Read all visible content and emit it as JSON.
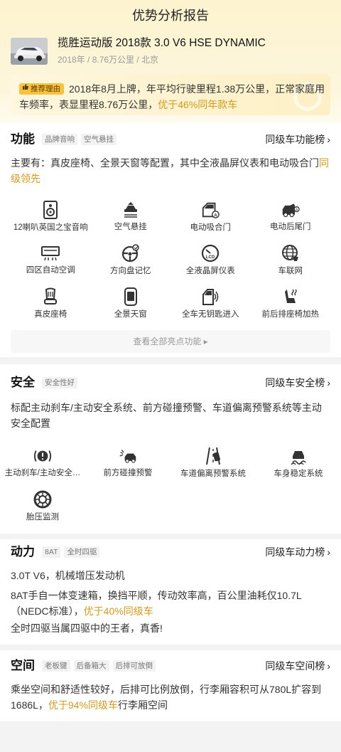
{
  "header": {
    "title": "优势分析报告"
  },
  "car": {
    "name": "揽胜运动版 2018款 3.0 V6 HSE DYNAMIC",
    "meta": "2018年 / 8.76万公里 / 北京"
  },
  "reason": {
    "badge": "推荐理由",
    "text_main": "2018年8月上牌，年平均行驶里程1.38万公里，正常家庭用车频率，表显里程8.76万公里，",
    "text_highlight": "优于46%同年款车"
  },
  "function": {
    "title": "功能",
    "tags": [
      "品牌音响",
      "空气悬挂"
    ],
    "rank_label": "同级车功能榜",
    "desc_main": "主要有：真皮座椅、全景天窗等配置，其中全液晶屏仪表和电动吸合门",
    "desc_highlight": "同级领先",
    "features": [
      {
        "label": "12喇叭英国之宝音响",
        "icon": "speaker-icon"
      },
      {
        "label": "空气悬挂",
        "icon": "air-suspension-icon"
      },
      {
        "label": "电动吸合门",
        "icon": "power-door-icon"
      },
      {
        "label": "电动后尾门",
        "icon": "power-tailgate-icon"
      },
      {
        "label": "四区自动空调",
        "icon": "climate-control-icon"
      },
      {
        "label": "方向盘记忆",
        "icon": "steering-wheel-icon"
      },
      {
        "label": "全液晶屏仪表",
        "icon": "lcd-dashboard-icon"
      },
      {
        "label": "车联网",
        "icon": "globe-icon"
      },
      {
        "label": "真皮座椅",
        "icon": "leather-seat-icon"
      },
      {
        "label": "全景天窗",
        "icon": "sunroof-icon"
      },
      {
        "label": "全车无钥匙进入",
        "icon": "keyless-entry-icon"
      },
      {
        "label": "前后排座椅加热",
        "icon": "seat-heating-icon"
      }
    ],
    "view_all": "查看全部亮点功能 ▸"
  },
  "safety": {
    "title": "安全",
    "tags": [
      "安全性好"
    ],
    "rank_label": "同级车安全榜",
    "desc": "标配主动刹车/主动安全系统、前方碰撞预警、车道偏离预警系统等主动安全配置",
    "features": [
      {
        "label": "主动刹车/主动安全…",
        "icon": "brake-warning-icon"
      },
      {
        "label": "前方碰撞预警",
        "icon": "collision-warning-icon"
      },
      {
        "label": "车道偏离预警系统",
        "icon": "lane-departure-icon"
      },
      {
        "label": "车身稳定系统",
        "icon": "stability-control-icon"
      },
      {
        "label": "胎压监测",
        "icon": "tire-pressure-icon"
      }
    ]
  },
  "power": {
    "title": "动力",
    "tags": [
      "8AT",
      "全时四驱"
    ],
    "rank_label": "同级车动力榜",
    "line1": "3.0T V6，机械增压发动机",
    "line2_main": "8AT手自一体变速箱，换挡平顺，传动效率高，百公里油耗仅10.7L（NEDC标准），",
    "line2_highlight": "优于40%同级车",
    "line3": "全时四驱当属四驱中的王者，真香!"
  },
  "space": {
    "title": "空间",
    "tags": [
      "老板键",
      "后备箱大",
      "后排可放倒"
    ],
    "rank_label": "同级车空间榜",
    "desc_main": "乘坐空间和舒适性较好，后排可比例放倒，行李厢容积可从780L扩容到1686L，",
    "desc_highlight": "优于94%同级车",
    "desc_tail": "行李厢空间"
  },
  "colors": {
    "accent": "#d69a1a",
    "badge": "#f9c23c",
    "icon": "#333333"
  }
}
